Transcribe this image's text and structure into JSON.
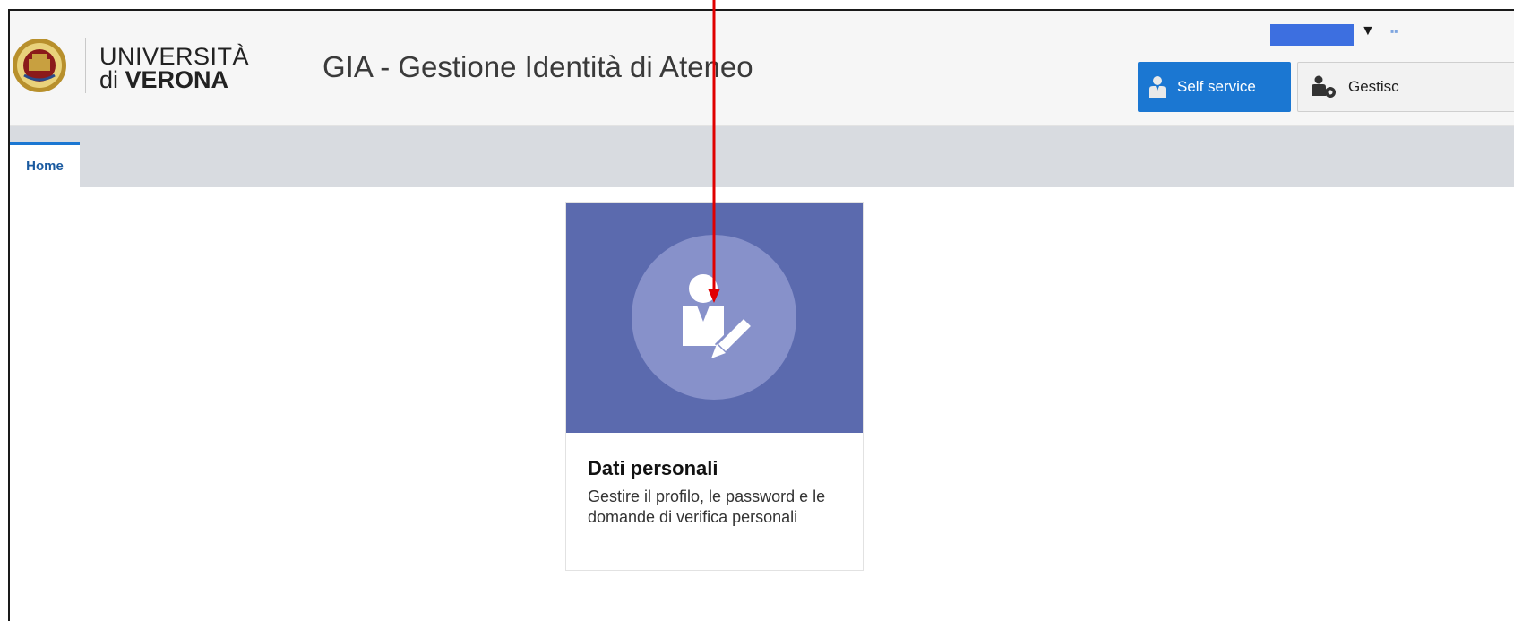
{
  "header": {
    "logo": {
      "line1": "UNIVERSITÀ",
      "line2_pre": "di ",
      "line2_bold": "VERONA"
    },
    "app_title": "GIA - Gestione Identità di Ateneo",
    "buttons": [
      {
        "label": "Self service",
        "icon": "user-icon",
        "color": "#1b77d2"
      },
      {
        "label": "Gestisc",
        "icon": "user-gear-icon",
        "color": "#f2f2f2"
      }
    ]
  },
  "tabs": [
    {
      "label": "Home",
      "active": true
    }
  ],
  "card": {
    "title": "Dati personali",
    "description": "Gestire il profilo, le password e le domande di verifica personali",
    "icon": "user-edit-icon",
    "hero_color": "#5b6aae"
  },
  "annotation": {
    "icon": "red-arrow",
    "color": "#e00000"
  }
}
